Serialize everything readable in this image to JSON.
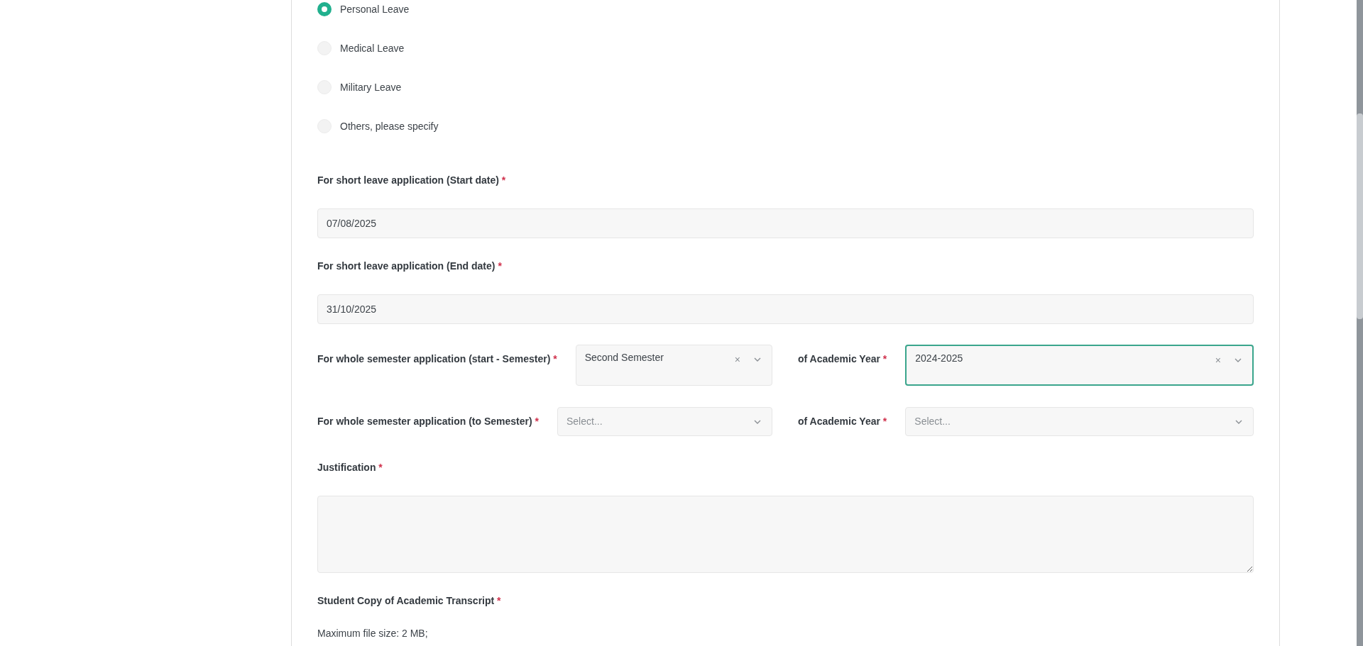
{
  "leave_types": [
    {
      "label": "Personal Leave",
      "selected": true
    },
    {
      "label": "Medical Leave",
      "selected": false
    },
    {
      "label": "Military Leave",
      "selected": false
    },
    {
      "label": "Others, please specify",
      "selected": false
    }
  ],
  "start_date": {
    "label": "For short leave application (Start date)",
    "required_mark": "*",
    "value": "07/08/2025"
  },
  "end_date": {
    "label": "For short leave application (End date)",
    "required_mark": "*",
    "value": "31/10/2025"
  },
  "semester_rows": [
    {
      "semester": {
        "label": "For whole semester application (start - Semester)",
        "required_mark": "*",
        "value": "Second Semester",
        "clear": "×",
        "focused": false
      },
      "year": {
        "label": "of Academic Year",
        "required_mark": "*",
        "value": "2024-2025",
        "clear": "×",
        "focused": true
      }
    },
    {
      "semester": {
        "label": "For whole semester application (to Semester)",
        "required_mark": "*",
        "placeholder": "Select...",
        "focused": false
      },
      "year": {
        "label": "of Academic Year",
        "required_mark": "*",
        "placeholder": "Select...",
        "focused": false
      }
    }
  ],
  "justification": {
    "label": "Justification",
    "required_mark": "*"
  },
  "transcript": {
    "label": "Student Copy of Academic Transcript",
    "required_mark": "*",
    "note": "Maximum file size: 2 MB;"
  }
}
